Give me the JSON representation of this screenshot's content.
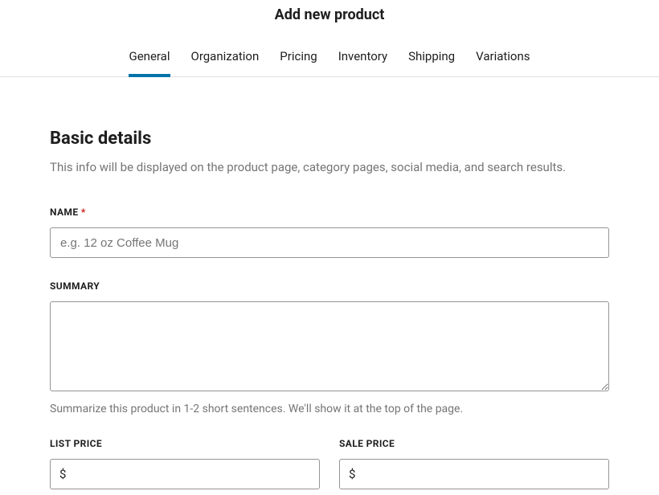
{
  "header": {
    "title": "Add new product"
  },
  "tabs": [
    {
      "label": "General",
      "active": true
    },
    {
      "label": "Organization",
      "active": false
    },
    {
      "label": "Pricing",
      "active": false
    },
    {
      "label": "Inventory",
      "active": false
    },
    {
      "label": "Shipping",
      "active": false
    },
    {
      "label": "Variations",
      "active": false
    }
  ],
  "section": {
    "title": "Basic details",
    "description": "This info will be displayed on the product page, category pages, social media, and search results."
  },
  "fields": {
    "name": {
      "label": "NAME",
      "required": "*",
      "placeholder": "e.g. 12 oz Coffee Mug",
      "value": ""
    },
    "summary": {
      "label": "SUMMARY",
      "value": "",
      "help": "Summarize this product in 1-2 short sentences. We'll show it at the top of the page."
    },
    "list_price": {
      "label": "LIST PRICE",
      "currency": "$",
      "value": ""
    },
    "sale_price": {
      "label": "SALE PRICE",
      "currency": "$",
      "value": ""
    }
  }
}
